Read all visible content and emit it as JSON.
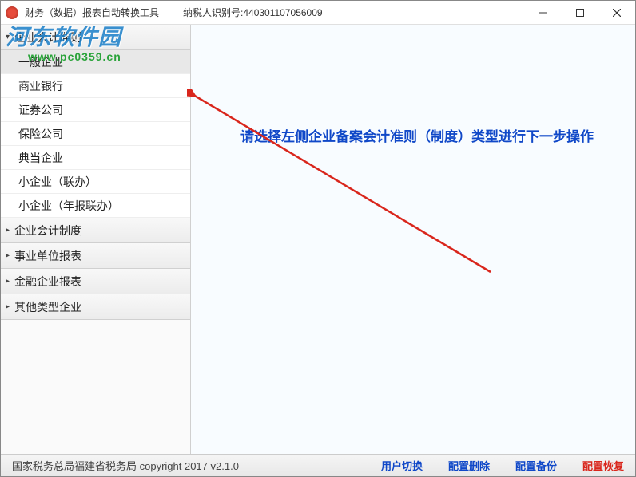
{
  "titlebar": {
    "app_title": "财务（数据）报表自动转换工具",
    "tax_label": "纳税人识别号:440301107056009"
  },
  "watermark": {
    "line1": "河东软件园",
    "line2": "www.pc0359.cn"
  },
  "sidebar": {
    "sections": [
      {
        "label": "企业会计准则",
        "expanded": true,
        "items": [
          "一般企业",
          "商业银行",
          "证券公司",
          "保险公司",
          "典当企业",
          "小企业（联办）",
          "小企业（年报联办）"
        ]
      },
      {
        "label": "企业会计制度",
        "expanded": false
      },
      {
        "label": "事业单位报表",
        "expanded": false
      },
      {
        "label": "金融企业报表",
        "expanded": false
      },
      {
        "label": "其他类型企业",
        "expanded": false
      }
    ]
  },
  "main": {
    "hint": "请选择左侧企业备案会计准则（制度）类型进行下一步操作"
  },
  "statusbar": {
    "copyright": "国家税务总局福建省税务局  copyright 2017  v2.1.0",
    "links": {
      "user_switch": "用户切换",
      "config_delete": "配置删除",
      "config_backup": "配置备份",
      "config_restore": "配置恢复"
    }
  }
}
